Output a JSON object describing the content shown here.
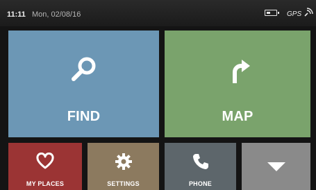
{
  "status_bar": {
    "time": "11:11",
    "date": "Mon, 02/08/16",
    "gps_label": "GPS",
    "battery_icon": "battery-icon",
    "gps_signal_icon": "gps-signal-icon"
  },
  "tiles": {
    "find": {
      "label": "FIND",
      "icon": "search-icon",
      "color": "#6c97b5"
    },
    "map": {
      "label": "MAP",
      "icon": "route-arrow-icon",
      "color": "#7aa36c"
    },
    "my_places": {
      "label": "MY PLACES",
      "icon": "heart-icon",
      "color": "#9b3434"
    },
    "settings": {
      "label": "SETTINGS",
      "icon": "gear-icon",
      "color": "#8c7a5f"
    },
    "phone": {
      "label": "PHONE",
      "icon": "phone-icon",
      "color": "#5d666b"
    },
    "more": {
      "icon": "chevron-down-icon",
      "color": "#8a8a8a"
    }
  }
}
